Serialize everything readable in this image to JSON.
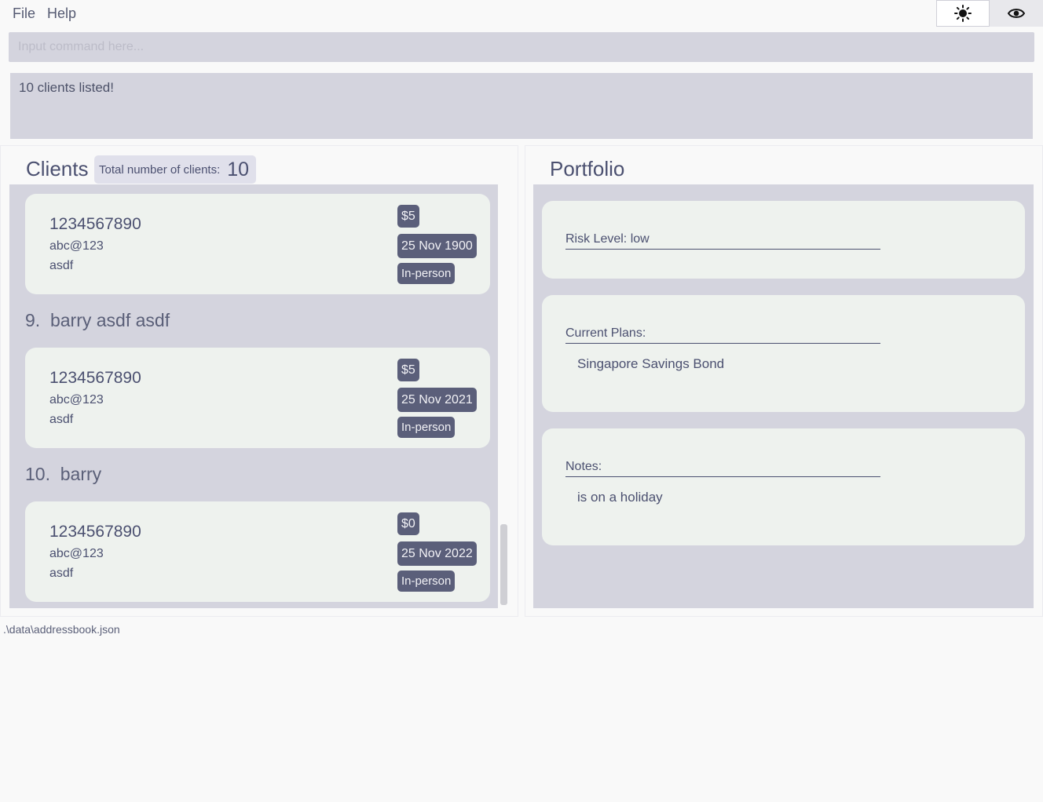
{
  "menu": {
    "file": "File",
    "help": "Help"
  },
  "theme_buttons": {
    "light_icon": "sun-icon",
    "eye_icon": "eye-icon"
  },
  "command": {
    "placeholder": "Input command here..."
  },
  "result": {
    "message": "10 clients listed!"
  },
  "clients_panel": {
    "title": "Clients",
    "count_label": "Total number of clients:",
    "count_value": "10",
    "cards": [
      {
        "phone": "1234567890",
        "email": "abc@123",
        "address": "asdf",
        "money": "$5",
        "date": "25 Nov 1900",
        "mode": "In-person"
      },
      {
        "phone": "1234567890",
        "email": "abc@123",
        "address": "asdf",
        "money": "$5",
        "date": "25 Nov 2021",
        "mode": "In-person"
      },
      {
        "phone": "1234567890",
        "email": "abc@123",
        "address": "asdf",
        "money": "$0",
        "date": "25 Nov 2022",
        "mode": "In-person"
      }
    ],
    "names": [
      {
        "index": "9.",
        "name": "barry asdf asdf"
      },
      {
        "index": "10.",
        "name": "barry"
      }
    ]
  },
  "portfolio": {
    "title": "Portfolio",
    "risk_label": "Risk Level: low",
    "plans_label": "Current Plans:",
    "plans_value": "Singapore Savings Bond",
    "notes_label": "Notes:",
    "notes_value": "is on a holiday"
  },
  "footer": {
    "path": ".\\data\\addressbook.json"
  }
}
